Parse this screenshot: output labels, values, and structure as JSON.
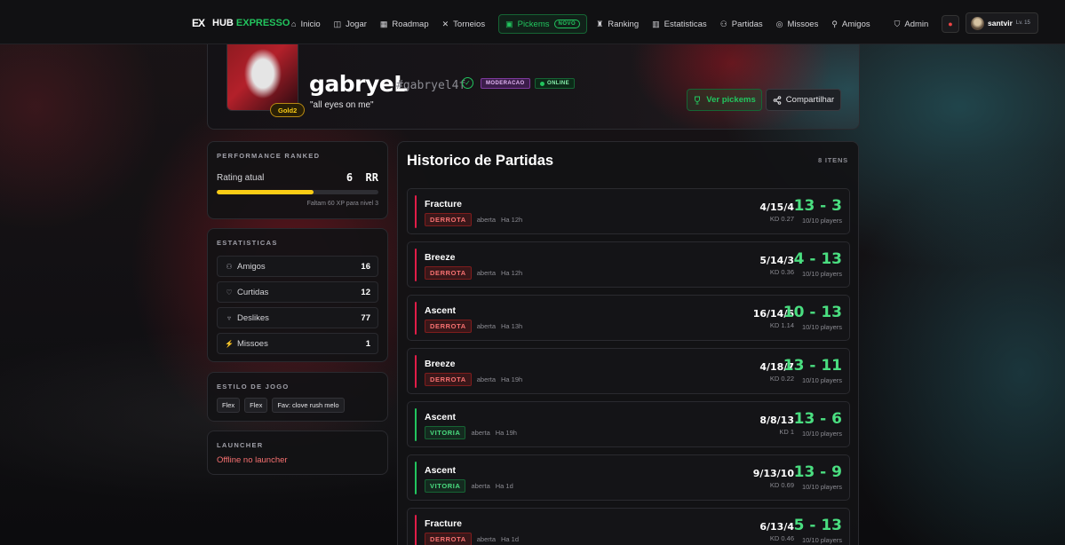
{
  "brand": {
    "logo_mark": "EX",
    "name_a": "HUB ",
    "name_b": "EXPRESSO"
  },
  "nav": {
    "items": [
      {
        "label": "Inicio",
        "icon": "home-icon"
      },
      {
        "label": "Jogar",
        "icon": "gamepad-icon"
      },
      {
        "label": "Roadmap",
        "icon": "calendar-icon"
      },
      {
        "label": "Torneios",
        "icon": "swords-icon"
      },
      {
        "label": "Pickems",
        "icon": "clipboard-icon",
        "badge": "NOVO"
      },
      {
        "label": "Ranking",
        "icon": "trophy-icon"
      },
      {
        "label": "Estatisticas",
        "icon": "chart-icon"
      },
      {
        "label": "Partidas",
        "icon": "users-icon"
      },
      {
        "label": "Missoes",
        "icon": "target-icon"
      },
      {
        "label": "Amigos",
        "icon": "user-icon"
      },
      {
        "label": "Admin",
        "icon": "shield-icon"
      }
    ],
    "user": {
      "name": "santvir",
      "level": "Lv. 15"
    }
  },
  "profile": {
    "name": "gabryeL",
    "tag": "#gabryel4f",
    "badge_mod": "MODERACAO",
    "badge_online": "ONLINE",
    "quote": "\"all eyes on me\"",
    "rank": "Gold2",
    "btn_picks": "Ver pickems",
    "btn_share": "Compartilhar"
  },
  "performance": {
    "title": "PERFORMANCE RANKED",
    "rating_label": "Rating atual",
    "rating_value": "6  RR",
    "progress": 0.6,
    "hint": "Faltam 60 XP para nivel 3"
  },
  "stats": {
    "title": "ESTATISTICAS",
    "rows": [
      {
        "label": "Amigos",
        "value": "16",
        "icon": "users-icon"
      },
      {
        "label": "Curtidas",
        "value": "12",
        "icon": "heart-icon"
      },
      {
        "label": "Deslikes",
        "value": "77",
        "icon": "thumbs-down-icon"
      },
      {
        "label": "Missoes",
        "value": "1",
        "icon": "bolt-icon"
      }
    ]
  },
  "play_style": {
    "title": "ESTILO DE JOGO",
    "chips": [
      "Flex",
      "Flex",
      "Fav: clove rush melo"
    ]
  },
  "launcher": {
    "title": "LAUNCHER",
    "status": "Offline no launcher"
  },
  "history": {
    "title": "Historico de Partidas",
    "count": "8 ITENS",
    "matches": [
      {
        "map": "Fracture",
        "result": "DERROTA",
        "type": "aberta",
        "when": "Ha 12h",
        "kda": "4/15/4",
        "kd": "KD 0.27",
        "score": "13 - 3",
        "players": "10/10 players"
      },
      {
        "map": "Breeze",
        "result": "DERROTA",
        "type": "aberta",
        "when": "Ha 12h",
        "kda": "5/14/3",
        "kd": "KD 0.36",
        "score": "4 - 13",
        "players": "10/10 players"
      },
      {
        "map": "Ascent",
        "result": "DERROTA",
        "type": "aberta",
        "when": "Ha 13h",
        "kda": "16/14/6",
        "kd": "KD 1.14",
        "score": "10 - 13",
        "players": "10/10 players"
      },
      {
        "map": "Breeze",
        "result": "DERROTA",
        "type": "aberta",
        "when": "Ha 19h",
        "kda": "4/18/7",
        "kd": "KD 0.22",
        "score": "13 - 11",
        "players": "10/10 players"
      },
      {
        "map": "Ascent",
        "result": "VITORIA",
        "type": "aberta",
        "when": "Ha 19h",
        "kda": "8/8/13",
        "kd": "KD 1",
        "score": "13 - 6",
        "players": "10/10 players"
      },
      {
        "map": "Ascent",
        "result": "VITORIA",
        "type": "aberta",
        "when": "Ha 1d",
        "kda": "9/13/10",
        "kd": "KD 0.69",
        "score": "13 - 9",
        "players": "10/10 players"
      },
      {
        "map": "Fracture",
        "result": "DERROTA",
        "type": "aberta",
        "when": "Ha 1d",
        "kda": "6/13/4",
        "kd": "KD 0.46",
        "score": "5 - 13",
        "players": "10/10 players"
      }
    ]
  },
  "colors": {
    "accent": "#22c55e",
    "loss": "#e11d48",
    "win": "#22c55e",
    "gold": "#facc15"
  }
}
